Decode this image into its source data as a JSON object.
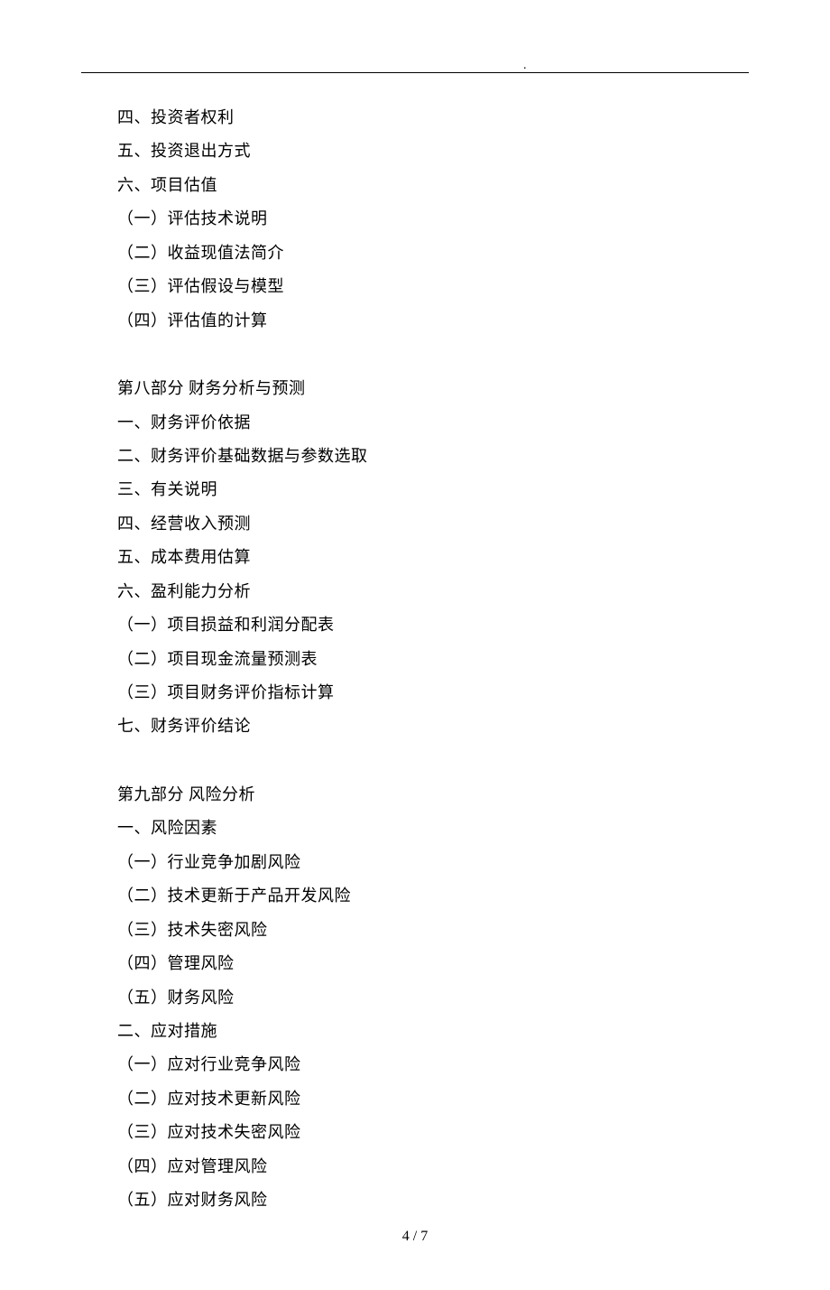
{
  "header": {
    "dot": "."
  },
  "content": {
    "lines": [
      "四、投资者权利",
      "五、投资退出方式",
      "六、项目估值",
      "（一）评估技术说明",
      "（二）收益现值法简介",
      "（三）评估假设与模型",
      "（四）评估值的计算",
      "",
      "第八部分 财务分析与预测",
      "一、财务评价依据",
      "二、财务评价基础数据与参数选取",
      "三、有关说明",
      "四、经营收入预测",
      "五、成本费用估算",
      "六、盈利能力分析",
      "（一）项目损益和利润分配表",
      "（二）项目现金流量预测表",
      "（三）项目财务评价指标计算",
      "七、财务评价结论",
      "",
      "第九部分 风险分析",
      "一、风险因素",
      "（一）行业竞争加剧风险",
      "（二）技术更新于产品开发风险",
      "（三）技术失密风险",
      "（四）管理风险",
      "（五）财务风险",
      "二、应对措施",
      "（一）应对行业竞争风险",
      "（二）应对技术更新风险",
      "（三）应对技术失密风险",
      "（四）应对管理风险",
      "（五）应对财务风险"
    ]
  },
  "footer": {
    "page_number": "4 / 7"
  }
}
